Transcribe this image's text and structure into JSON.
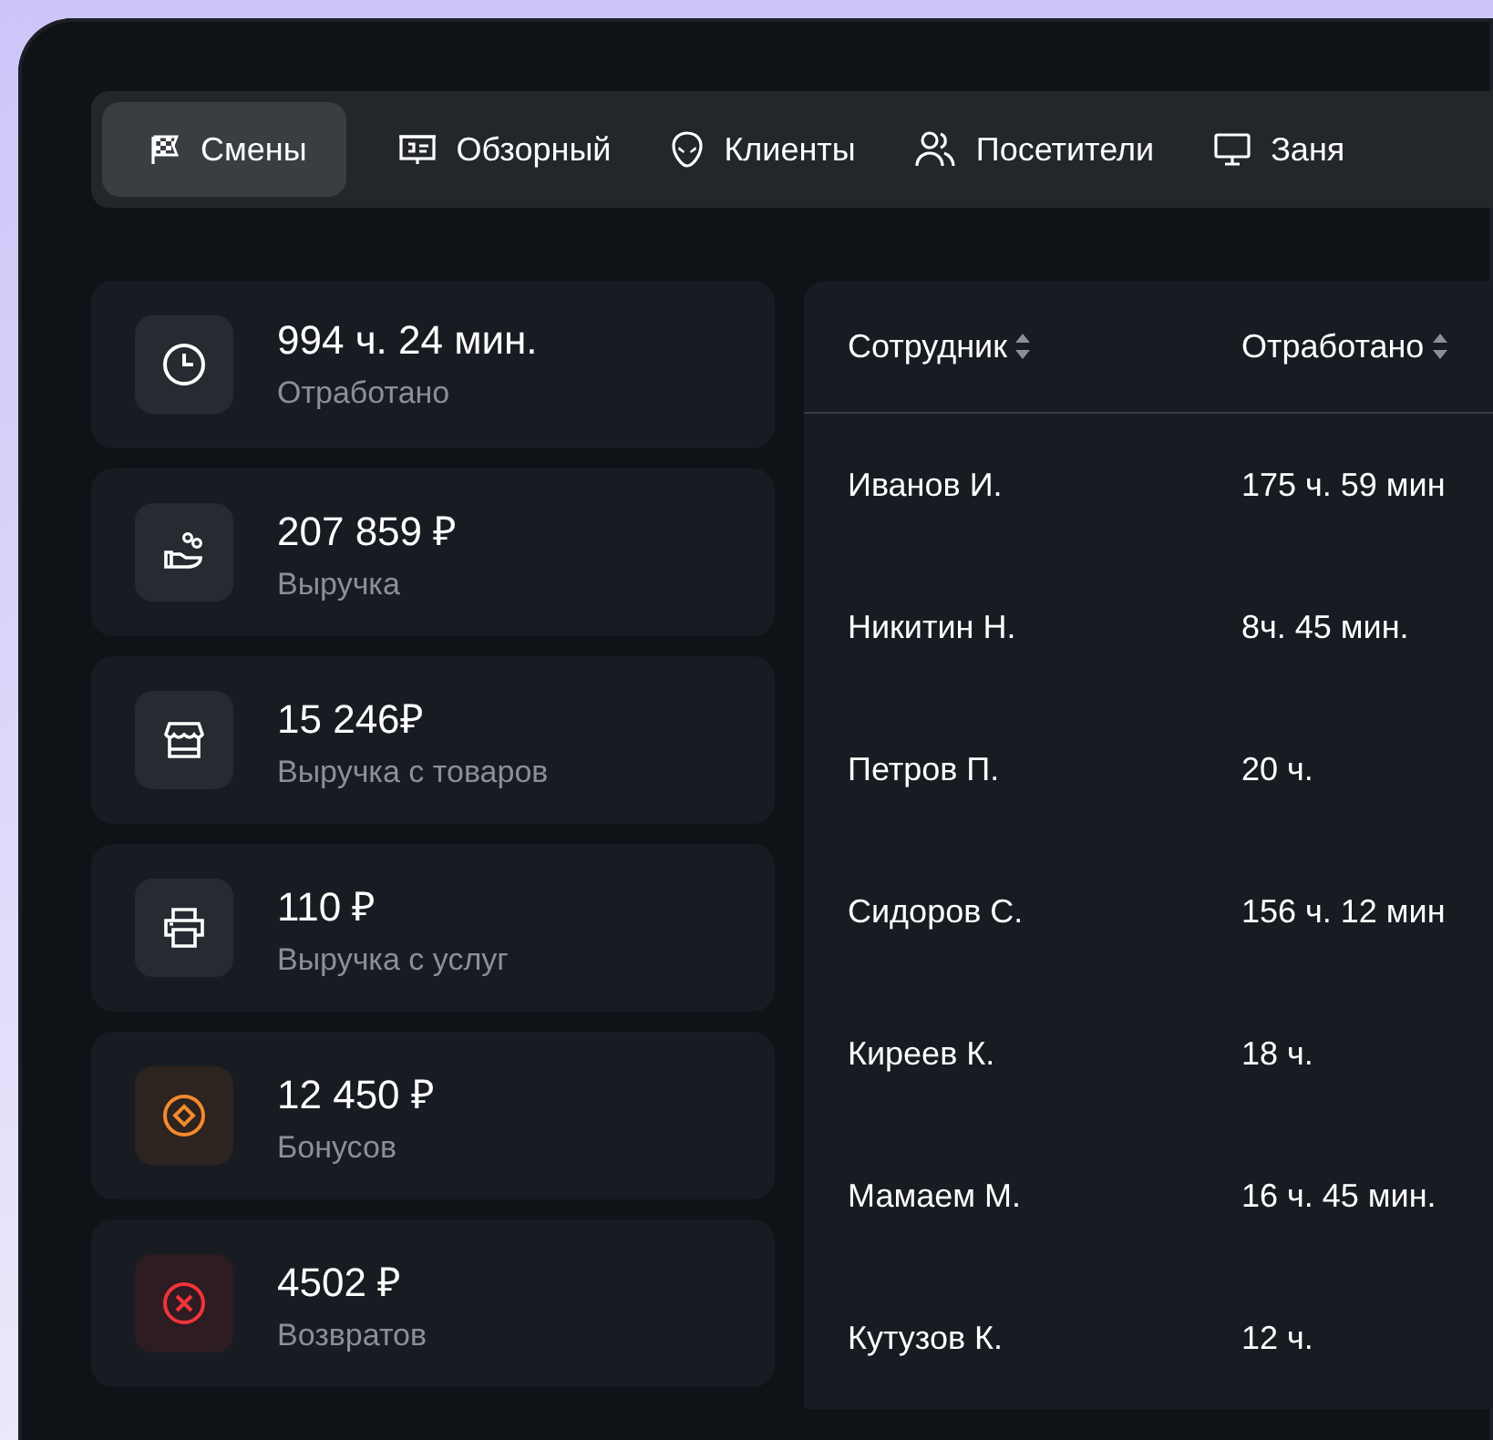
{
  "tabs": [
    {
      "label": "Смены",
      "kind": "flag",
      "selected": true
    },
    {
      "label": "Обзорный",
      "kind": "presentation",
      "selected": false
    },
    {
      "label": "Клиенты",
      "kind": "alien",
      "selected": false
    },
    {
      "label": "Посетители",
      "kind": "users",
      "selected": false
    },
    {
      "label": "Заня",
      "kind": "monitor",
      "selected": false
    }
  ],
  "stats": [
    {
      "value": "994 ч. 24 мин.",
      "label": "Отработано",
      "kind": "clock"
    },
    {
      "value": "207 859 ₽",
      "label": "Выручка",
      "kind": "hand-coins"
    },
    {
      "value": "15 246₽",
      "label": "Выручка с товаров",
      "kind": "shop"
    },
    {
      "value": "110 ₽",
      "label": "Выручка с услуг",
      "kind": "printer"
    },
    {
      "value": "12 450 ₽",
      "label": "Бонусов",
      "kind": "bonus"
    },
    {
      "value": "4502 ₽",
      "label": "Возвратов",
      "kind": "refund"
    }
  ],
  "table": {
    "columns": [
      "Сотрудник",
      "Отработано"
    ],
    "rows": [
      [
        "Иванов И.",
        "175 ч. 59 мин"
      ],
      [
        "Никитин Н.",
        "8ч. 45 мин."
      ],
      [
        "Петров П.",
        "20 ч."
      ],
      [
        "Сидоров С.",
        "156 ч. 12 мин"
      ],
      [
        "Киреев К.",
        "18 ч."
      ],
      [
        "Мамаем М.",
        "16 ч. 45 мин."
      ],
      [
        "Кутузов К.",
        "12 ч."
      ]
    ]
  }
}
